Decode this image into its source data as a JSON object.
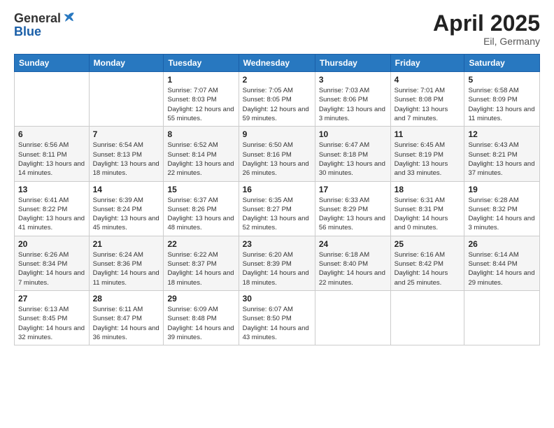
{
  "header": {
    "logo_general": "General",
    "logo_blue": "Blue",
    "title": "April 2025",
    "location": "Eil, Germany"
  },
  "weekdays": [
    "Sunday",
    "Monday",
    "Tuesday",
    "Wednesday",
    "Thursday",
    "Friday",
    "Saturday"
  ],
  "weeks": [
    [
      {
        "day": "",
        "info": ""
      },
      {
        "day": "",
        "info": ""
      },
      {
        "day": "1",
        "info": "Sunrise: 7:07 AM\nSunset: 8:03 PM\nDaylight: 12 hours\nand 55 minutes."
      },
      {
        "day": "2",
        "info": "Sunrise: 7:05 AM\nSunset: 8:05 PM\nDaylight: 12 hours\nand 59 minutes."
      },
      {
        "day": "3",
        "info": "Sunrise: 7:03 AM\nSunset: 8:06 PM\nDaylight: 13 hours\nand 3 minutes."
      },
      {
        "day": "4",
        "info": "Sunrise: 7:01 AM\nSunset: 8:08 PM\nDaylight: 13 hours\nand 7 minutes."
      },
      {
        "day": "5",
        "info": "Sunrise: 6:58 AM\nSunset: 8:09 PM\nDaylight: 13 hours\nand 11 minutes."
      }
    ],
    [
      {
        "day": "6",
        "info": "Sunrise: 6:56 AM\nSunset: 8:11 PM\nDaylight: 13 hours\nand 14 minutes."
      },
      {
        "day": "7",
        "info": "Sunrise: 6:54 AM\nSunset: 8:13 PM\nDaylight: 13 hours\nand 18 minutes."
      },
      {
        "day": "8",
        "info": "Sunrise: 6:52 AM\nSunset: 8:14 PM\nDaylight: 13 hours\nand 22 minutes."
      },
      {
        "day": "9",
        "info": "Sunrise: 6:50 AM\nSunset: 8:16 PM\nDaylight: 13 hours\nand 26 minutes."
      },
      {
        "day": "10",
        "info": "Sunrise: 6:47 AM\nSunset: 8:18 PM\nDaylight: 13 hours\nand 30 minutes."
      },
      {
        "day": "11",
        "info": "Sunrise: 6:45 AM\nSunset: 8:19 PM\nDaylight: 13 hours\nand 33 minutes."
      },
      {
        "day": "12",
        "info": "Sunrise: 6:43 AM\nSunset: 8:21 PM\nDaylight: 13 hours\nand 37 minutes."
      }
    ],
    [
      {
        "day": "13",
        "info": "Sunrise: 6:41 AM\nSunset: 8:22 PM\nDaylight: 13 hours\nand 41 minutes."
      },
      {
        "day": "14",
        "info": "Sunrise: 6:39 AM\nSunset: 8:24 PM\nDaylight: 13 hours\nand 45 minutes."
      },
      {
        "day": "15",
        "info": "Sunrise: 6:37 AM\nSunset: 8:26 PM\nDaylight: 13 hours\nand 48 minutes."
      },
      {
        "day": "16",
        "info": "Sunrise: 6:35 AM\nSunset: 8:27 PM\nDaylight: 13 hours\nand 52 minutes."
      },
      {
        "day": "17",
        "info": "Sunrise: 6:33 AM\nSunset: 8:29 PM\nDaylight: 13 hours\nand 56 minutes."
      },
      {
        "day": "18",
        "info": "Sunrise: 6:31 AM\nSunset: 8:31 PM\nDaylight: 14 hours\nand 0 minutes."
      },
      {
        "day": "19",
        "info": "Sunrise: 6:28 AM\nSunset: 8:32 PM\nDaylight: 14 hours\nand 3 minutes."
      }
    ],
    [
      {
        "day": "20",
        "info": "Sunrise: 6:26 AM\nSunset: 8:34 PM\nDaylight: 14 hours\nand 7 minutes."
      },
      {
        "day": "21",
        "info": "Sunrise: 6:24 AM\nSunset: 8:36 PM\nDaylight: 14 hours\nand 11 minutes."
      },
      {
        "day": "22",
        "info": "Sunrise: 6:22 AM\nSunset: 8:37 PM\nDaylight: 14 hours\nand 18 minutes."
      },
      {
        "day": "23",
        "info": "Sunrise: 6:20 AM\nSunset: 8:39 PM\nDaylight: 14 hours\nand 18 minutes."
      },
      {
        "day": "24",
        "info": "Sunrise: 6:18 AM\nSunset: 8:40 PM\nDaylight: 14 hours\nand 22 minutes."
      },
      {
        "day": "25",
        "info": "Sunrise: 6:16 AM\nSunset: 8:42 PM\nDaylight: 14 hours\nand 25 minutes."
      },
      {
        "day": "26",
        "info": "Sunrise: 6:14 AM\nSunset: 8:44 PM\nDaylight: 14 hours\nand 29 minutes."
      }
    ],
    [
      {
        "day": "27",
        "info": "Sunrise: 6:13 AM\nSunset: 8:45 PM\nDaylight: 14 hours\nand 32 minutes."
      },
      {
        "day": "28",
        "info": "Sunrise: 6:11 AM\nSunset: 8:47 PM\nDaylight: 14 hours\nand 36 minutes."
      },
      {
        "day": "29",
        "info": "Sunrise: 6:09 AM\nSunset: 8:48 PM\nDaylight: 14 hours\nand 39 minutes."
      },
      {
        "day": "30",
        "info": "Sunrise: 6:07 AM\nSunset: 8:50 PM\nDaylight: 14 hours\nand 43 minutes."
      },
      {
        "day": "",
        "info": ""
      },
      {
        "day": "",
        "info": ""
      },
      {
        "day": "",
        "info": ""
      }
    ]
  ]
}
